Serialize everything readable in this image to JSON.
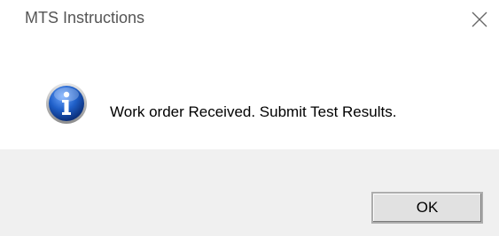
{
  "window": {
    "title": "MTS Instructions",
    "close_icon": "close-icon"
  },
  "message": {
    "icon": "info-icon",
    "text": "Work order Received. Submit Test Results."
  },
  "buttons": {
    "ok_label": "OK"
  },
  "colors": {
    "title_text": "#555555",
    "footer_bg": "#f0f0f0",
    "icon_blue": "#1a5fb4"
  }
}
